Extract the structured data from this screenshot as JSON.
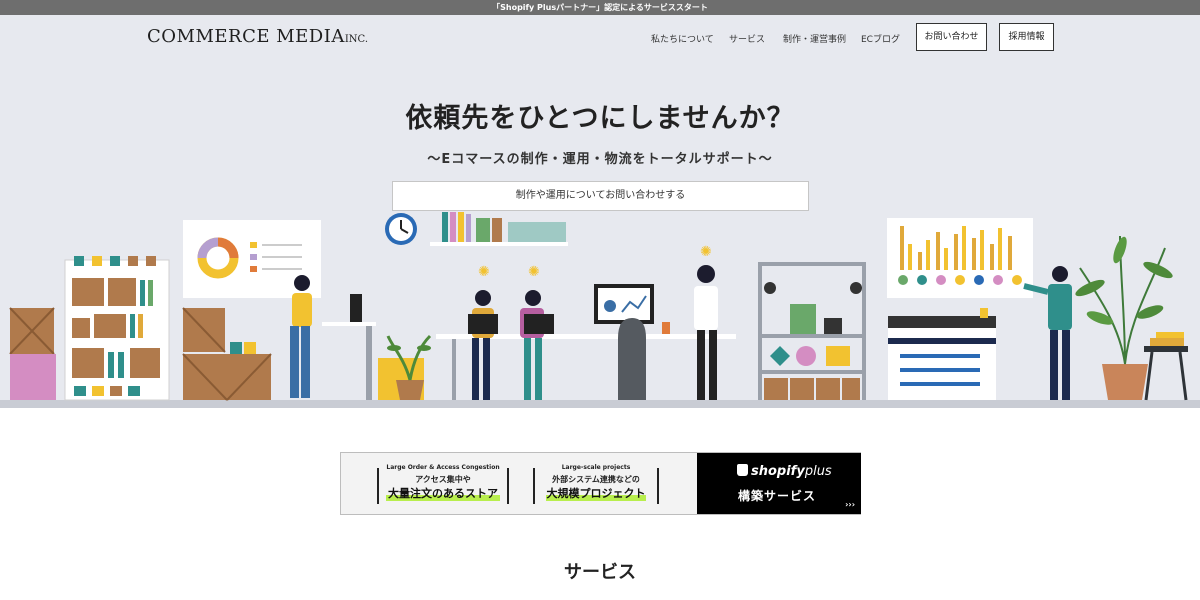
{
  "announcement": "「Shopify Plusパートナー」認定によるサービススタート",
  "header": {
    "logo_main": "COMMERCE MEDIA",
    "logo_suffix": "INC.",
    "nav": [
      "私たちについて",
      "サービス",
      "制作・運営事例",
      "ECブログ"
    ],
    "contact_label": "お問い合わせ",
    "recruit_label": "採用情報"
  },
  "hero": {
    "headline": "依頼先をひとつにしませんか？",
    "subheadline": "〜Eコマースの制作・運用・物流をトータルサポート〜",
    "cta_label": "制作や運用についてお問い合わせする"
  },
  "banner": {
    "item1_en": "Large Order & Access Congestion",
    "item1_jp1": "アクセス集中や",
    "item1_jp2": "大量注文のあるストア",
    "item2_en": "Large-scale projects",
    "item2_jp1": "外部システム連携などの",
    "item2_jp2": "大規模プロジェクト",
    "shopify_logo": "shopify",
    "shopify_plus": "plus",
    "shopify_service": "構築サービス",
    "arrow": "›››"
  },
  "section": {
    "title": "サービス"
  },
  "colors": {
    "hero_bg": "#e7e9ef",
    "accent_green": "#b8ee4d",
    "box_brown": "#b07a4c",
    "teal": "#2f8f8b",
    "yellow": "#f2c230"
  }
}
